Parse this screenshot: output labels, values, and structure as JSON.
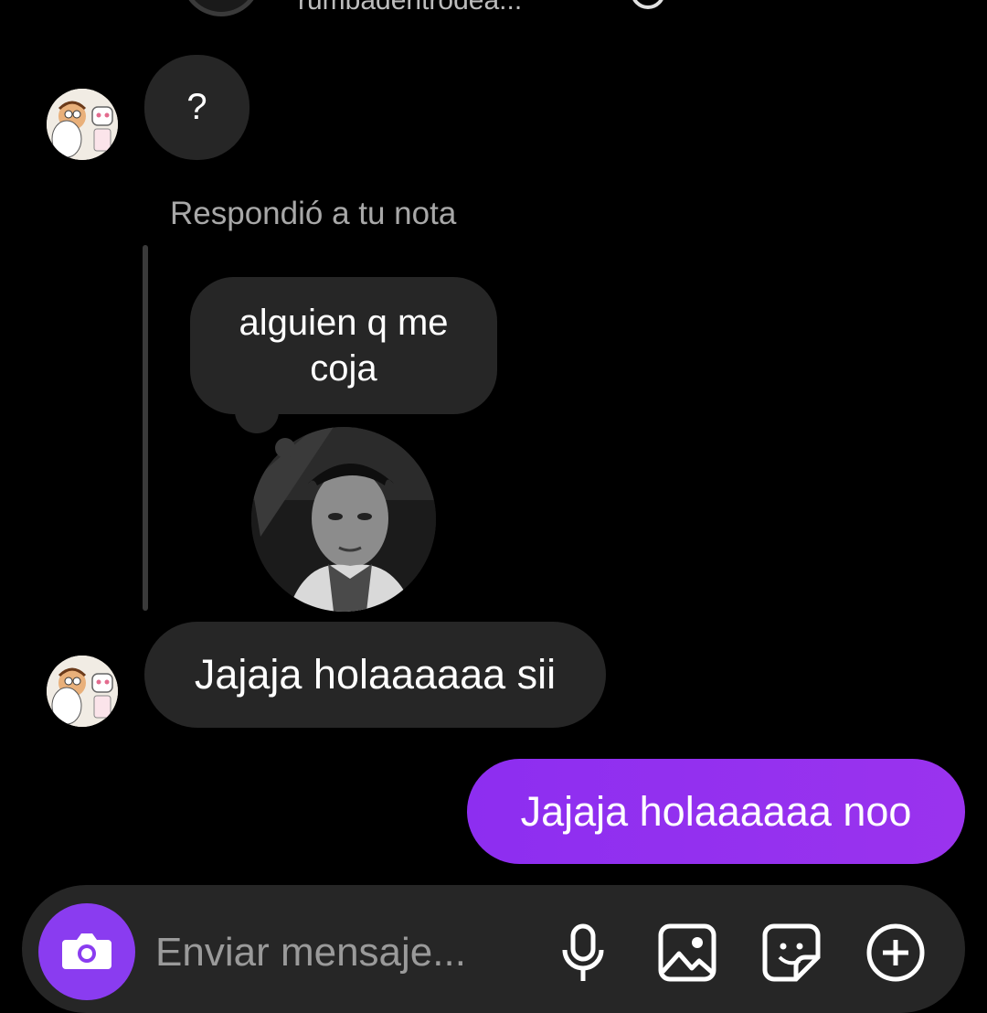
{
  "header": {
    "contact_name": "rumbadentrodea..."
  },
  "messages": {
    "first_incoming": "?",
    "reply_label": "Respondió a tu nota",
    "note_text": "alguien q me coja",
    "second_incoming": "Jajaja holaaaaaa sii",
    "outgoing": "Jajaja holaaaaaa noo"
  },
  "composer": {
    "placeholder": "Enviar mensaje..."
  },
  "icons": {
    "camera": "camera-icon",
    "microphone": "microphone-icon",
    "gallery": "image-icon",
    "sticker": "sticker-icon",
    "add": "plus-circle-icon"
  },
  "colors": {
    "background": "#000000",
    "incoming_bubble": "#262626",
    "outgoing_bubble": "#8a2be2",
    "camera_button": "#8a3cf0",
    "muted_text": "#a8a8a8"
  }
}
